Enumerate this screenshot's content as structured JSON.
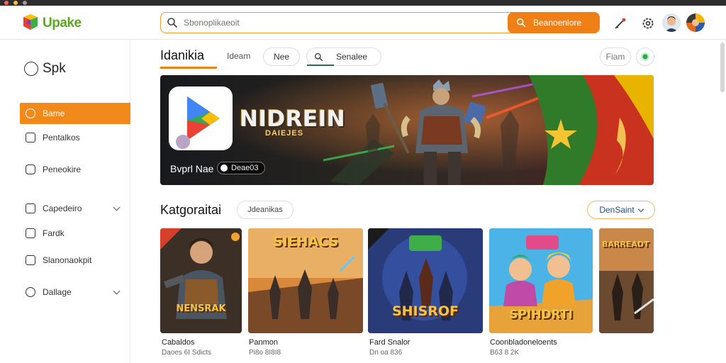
{
  "app": {
    "logo_text": "Upake"
  },
  "colors": {
    "accent": "#f07f16",
    "active_nav": "#f28a1b",
    "logo_green": "#5aa81f"
  },
  "search": {
    "placeholder": "Sbonoplikaeoit",
    "button_label": "Beanoenlore"
  },
  "header_icons": [
    "pen-icon",
    "gear-icon",
    "user-avatar",
    "profile-avatar"
  ],
  "sidebar": {
    "brand": "Spk",
    "items": [
      {
        "label": "Bame",
        "icon": "home-icon",
        "active": true
      },
      {
        "label": "Pentalkos",
        "icon": "document-icon"
      },
      {
        "label": "Peneokire",
        "icon": "chat-icon"
      },
      {
        "label": "Capedeiro",
        "icon": "grid-icon",
        "expandable": true
      },
      {
        "label": "Fardk",
        "icon": "book-icon"
      },
      {
        "label": "Slanonaokpit",
        "icon": "list-icon"
      },
      {
        "label": "Dallage",
        "icon": "headset-icon",
        "expandable": true
      }
    ]
  },
  "main": {
    "title": "Idanikia",
    "tab_label": "Ideam",
    "pill_label": "Nee",
    "segment_label": "Senalee",
    "right_pill_label": "Fiam"
  },
  "banner": {
    "game_logo": "NIDREIN",
    "game_sub": "DAIEJES",
    "caption": "Bvprl Nae",
    "chip_label": "Deae03"
  },
  "categories": {
    "title": "Katgoraitai",
    "filter_label": "Jdeanikas",
    "sort_label": "DenSaint",
    "cards": [
      {
        "art_title": "NENSRAK",
        "name": "Cabaldos",
        "meta": "Daoes 6I Sdicts"
      },
      {
        "art_title": "SIEHACS",
        "name": "Panmon",
        "meta": "Pi8o 8I8I8"
      },
      {
        "art_title": "SHISROF",
        "name": "Fard Snalor",
        "meta": "Dn oa 836"
      },
      {
        "art_title": "SPIHDRTI",
        "name": "Coonbladoneloents",
        "meta": "B63 8 2K"
      },
      {
        "art_title": "BARREADT",
        "name": "",
        "meta": ""
      }
    ]
  }
}
